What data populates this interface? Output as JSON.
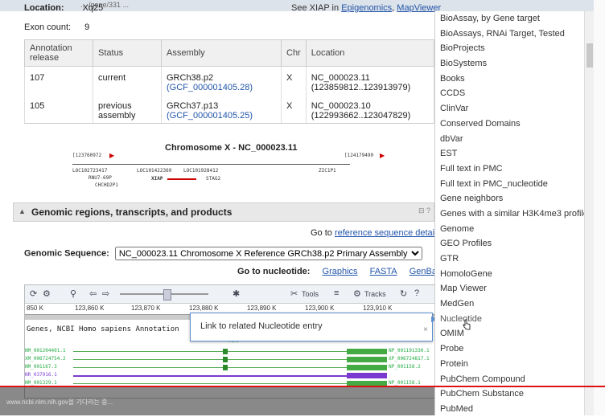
{
  "browser": {
    "url_partial": "... /gene/331 ..."
  },
  "gene_info": {
    "location_label": "Location:",
    "location_value": "Xq25",
    "see_also": "See XIAP in",
    "epigenomics_link": "Epigenomics",
    "map_viewer_link": "MapViewer",
    "exon_count_label": "Exon count:",
    "exon_count_value": "9"
  },
  "annotation_table": {
    "headers": [
      "Annotation release",
      "Status",
      "Assembly",
      "Chr",
      "Location"
    ],
    "rows": [
      {
        "release": "107",
        "status": "current",
        "assembly": "GRCh38.p2",
        "assembly_link": "(GCF_000001405.28)",
        "chr": "X",
        "location": "NC_000023.11",
        "range": "(123859812..123913979)"
      },
      {
        "release": "105",
        "status": "previous assembly",
        "assembly": "GRCh37.p13",
        "assembly_link": "(GCF_000001405.25)",
        "chr": "X",
        "location": "NC_000023.10",
        "range": "(122993662..123047829)"
      }
    ]
  },
  "chromosome_graphic": {
    "title": "Chromosome X - NC_000023.11",
    "left_coord": "[123760972",
    "right_coord": "[124179490",
    "genes_row1": [
      "LOC102723417",
      "LOC101422369",
      "LOC101928412",
      "ZIC1P1"
    ],
    "genes_row2": [
      "RNU7-69P",
      "XIAP",
      "STAG2"
    ],
    "genes_row3": [
      "CHCHD2P1"
    ]
  },
  "section": {
    "title": "Genomic regions, transcripts, and products",
    "goto_ref_prefix": "Go to",
    "goto_ref_link": "reference sequence details",
    "genomic_seq_label": "Genomic Sequence:",
    "genomic_seq_value": "NC_000023.11 Chromosome X Reference GRCh38.p2 Primary Assembly",
    "goto_nucleotide_label": "Go to nucleotide:",
    "graphics_link": "Graphics",
    "fasta_link": "FASTA",
    "genbank_link": "GenBank"
  },
  "viewer": {
    "tools_label": "Tools",
    "tracks_label": "Tracks",
    "ruler": [
      "850 K",
      "123,860 K",
      "123,870 K",
      "123,880 K",
      "123,890 K",
      "123,900 K",
      "123,910 K"
    ],
    "genes_annotation": "Genes, NCBI Homo sapiens Annotation",
    "gene_label": "XIAP",
    "tracks": [
      {
        "left": "NM_001204401.1",
        "right": "NP_001191330.1",
        "color": "#2a9a3a"
      },
      {
        "left": "XM_006724754.2",
        "right": "XP_006724817.1",
        "color": "#2a9a3a"
      },
      {
        "left": "NM_001167.3",
        "right": "NP_001158.2",
        "color": "#2a9a3a"
      },
      {
        "left": "NR_037916.1",
        "right": "",
        "color": "#7a3ad0"
      },
      {
        "left": "NM_001329.1",
        "right": "NP_001158.1",
        "color": "#2a9a3a"
      }
    ],
    "tooltip": "Link to related Nucleotide entry",
    "tooltip_close": "×"
  },
  "related_menu": {
    "items": [
      "BioAssay, by Gene target",
      "BioAssays, RNAi Target, Tested",
      "BioProjects",
      "BioSystems",
      "Books",
      "CCDS",
      "ClinVar",
      "Conserved Domains",
      "dbVar",
      "EST",
      "Full text in PMC",
      "Full text in PMC_nucleotide",
      "Gene neighbors",
      "Genes with a similar H3K4me3 profile",
      "Genome",
      "GEO Profiles",
      "GTR",
      "HomoloGene",
      "Map Viewer",
      "MedGen",
      "Nucleotide",
      "OMIM",
      "Probe",
      "Protein",
      "PubChem Compound",
      "PubChem Substance",
      "PubMed"
    ],
    "hovered_index": 20
  },
  "footer": {
    "status_text": "www.ncbi.nlm.nih.gov을 기다리는 중..."
  },
  "colors": {
    "link": "#2255aa",
    "tooltip_border": "#5b8fd0",
    "red_line": "#dd1111"
  }
}
